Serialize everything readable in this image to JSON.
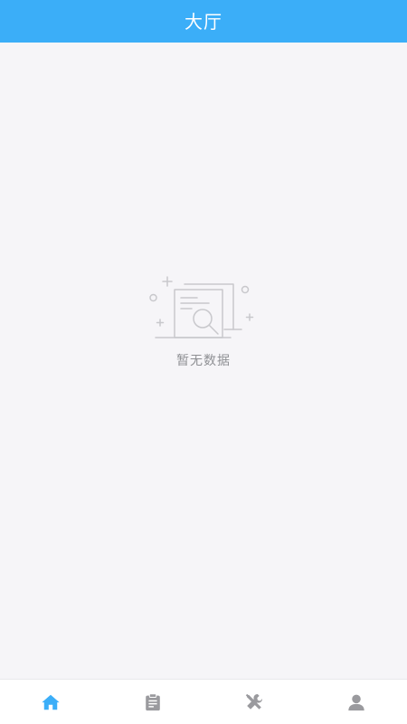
{
  "header": {
    "title": "大厅"
  },
  "empty_state": {
    "message": "暂无数据",
    "icon": "empty-document-search-icon"
  },
  "tabbar": {
    "active_index": 0,
    "active_color": "#3baef8",
    "inactive_color": "#9a9a9e",
    "items": [
      {
        "icon": "home-icon"
      },
      {
        "icon": "clipboard-icon"
      },
      {
        "icon": "tools-icon"
      },
      {
        "icon": "user-icon"
      }
    ]
  },
  "colors": {
    "header_background": "#3baef8",
    "page_background": "#f6f5f8",
    "tabbar_background": "#ffffff"
  }
}
